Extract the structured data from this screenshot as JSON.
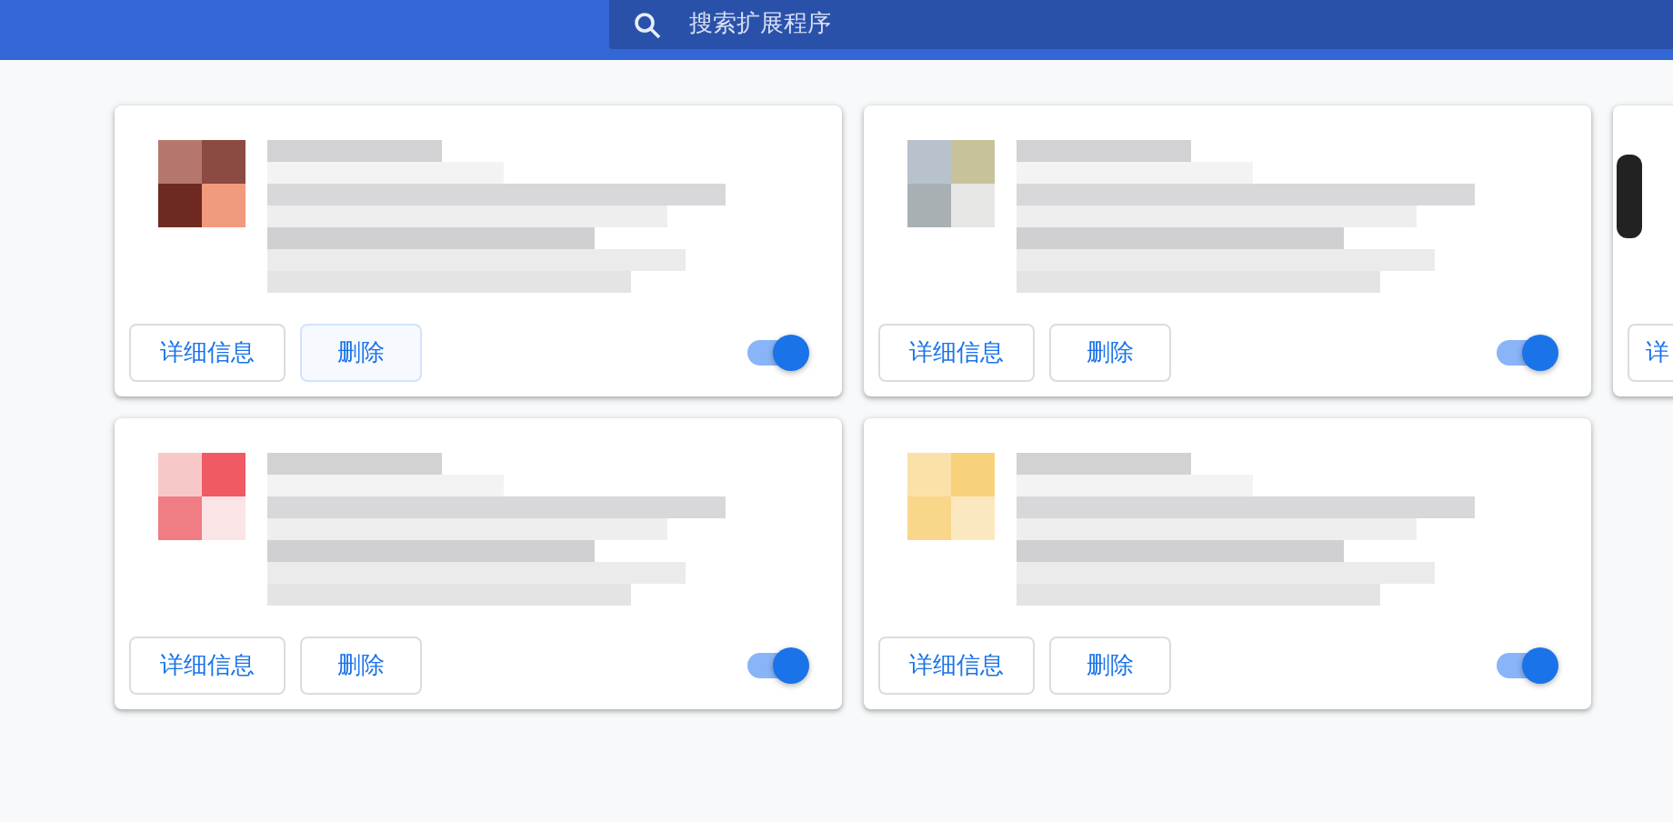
{
  "search": {
    "placeholder": "搜索扩展程序"
  },
  "extensions": [
    {
      "kind": "picture",
      "enabled": true,
      "buttons": [
        {
          "label": "详细信息",
          "focused": false
        },
        {
          "label": "删除",
          "focused": true
        }
      ]
    },
    {
      "kind": "picture",
      "enabled": true,
      "buttons": [
        {
          "label": "详细信息",
          "focused": false
        },
        {
          "label": "删除",
          "focused": false
        }
      ]
    },
    {
      "kind": "partial",
      "buttons": [
        {
          "label": "详",
          "focused": false
        }
      ]
    },
    {
      "kind": "picture",
      "enabled": true,
      "buttons": [
        {
          "label": "详细信息",
          "focused": false
        },
        {
          "label": "删除",
          "focused": false
        }
      ]
    },
    {
      "kind": "picture",
      "enabled": true,
      "buttons": [
        {
          "label": "详细信息",
          "focused": false
        },
        {
          "label": "删除",
          "focused": false
        }
      ]
    }
  ]
}
